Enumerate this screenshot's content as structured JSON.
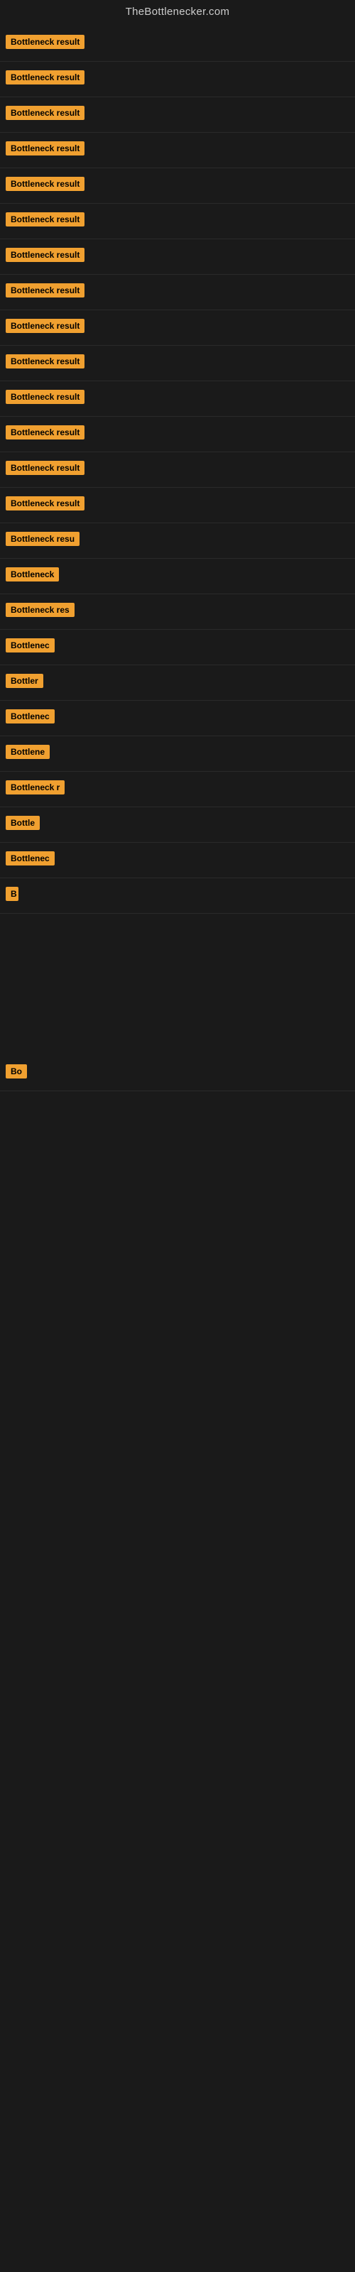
{
  "site": {
    "title": "TheBottlenecker.com"
  },
  "items": [
    {
      "label": "Bottleneck result",
      "truncation": "full",
      "index": 1
    },
    {
      "label": "Bottleneck result",
      "truncation": "full",
      "index": 2
    },
    {
      "label": "Bottleneck result",
      "truncation": "full",
      "index": 3
    },
    {
      "label": "Bottleneck result",
      "truncation": "full",
      "index": 4
    },
    {
      "label": "Bottleneck result",
      "truncation": "full",
      "index": 5
    },
    {
      "label": "Bottleneck result",
      "truncation": "full",
      "index": 6
    },
    {
      "label": "Bottleneck result",
      "truncation": "full",
      "index": 7
    },
    {
      "label": "Bottleneck result",
      "truncation": "full",
      "index": 8
    },
    {
      "label": "Bottleneck result",
      "truncation": "full",
      "index": 9
    },
    {
      "label": "Bottleneck result",
      "truncation": "full",
      "index": 10
    },
    {
      "label": "Bottleneck result",
      "truncation": "full",
      "index": 11
    },
    {
      "label": "Bottleneck result",
      "truncation": "full",
      "index": 12
    },
    {
      "label": "Bottleneck result",
      "truncation": "full",
      "index": 13
    },
    {
      "label": "Bottleneck result",
      "truncation": "full",
      "index": 14
    },
    {
      "label": "Bottleneck resu",
      "truncation": "truncated-lg",
      "index": 15
    },
    {
      "label": "Bottleneck",
      "truncation": "truncated-md",
      "index": 16
    },
    {
      "label": "Bottleneck res",
      "truncation": "truncated-lg",
      "index": 17
    },
    {
      "label": "Bottlenec",
      "truncation": "truncated-md",
      "index": 18
    },
    {
      "label": "Bottler",
      "truncation": "truncated-sm",
      "index": 19
    },
    {
      "label": "Bottlenec",
      "truncation": "truncated-md",
      "index": 20
    },
    {
      "label": "Bottlene",
      "truncation": "truncated-sm",
      "index": 21
    },
    {
      "label": "Bottleneck r",
      "truncation": "truncated-md",
      "index": 22
    },
    {
      "label": "Bottle",
      "truncation": "truncated-sm",
      "index": 23
    },
    {
      "label": "Bottlenec",
      "truncation": "truncated-md",
      "index": 24
    },
    {
      "label": "B",
      "truncation": "truncated-1ch",
      "index": 25
    }
  ],
  "late_items": [
    {
      "label": "Bo",
      "truncation": "truncated-xxs",
      "index": 26
    }
  ]
}
